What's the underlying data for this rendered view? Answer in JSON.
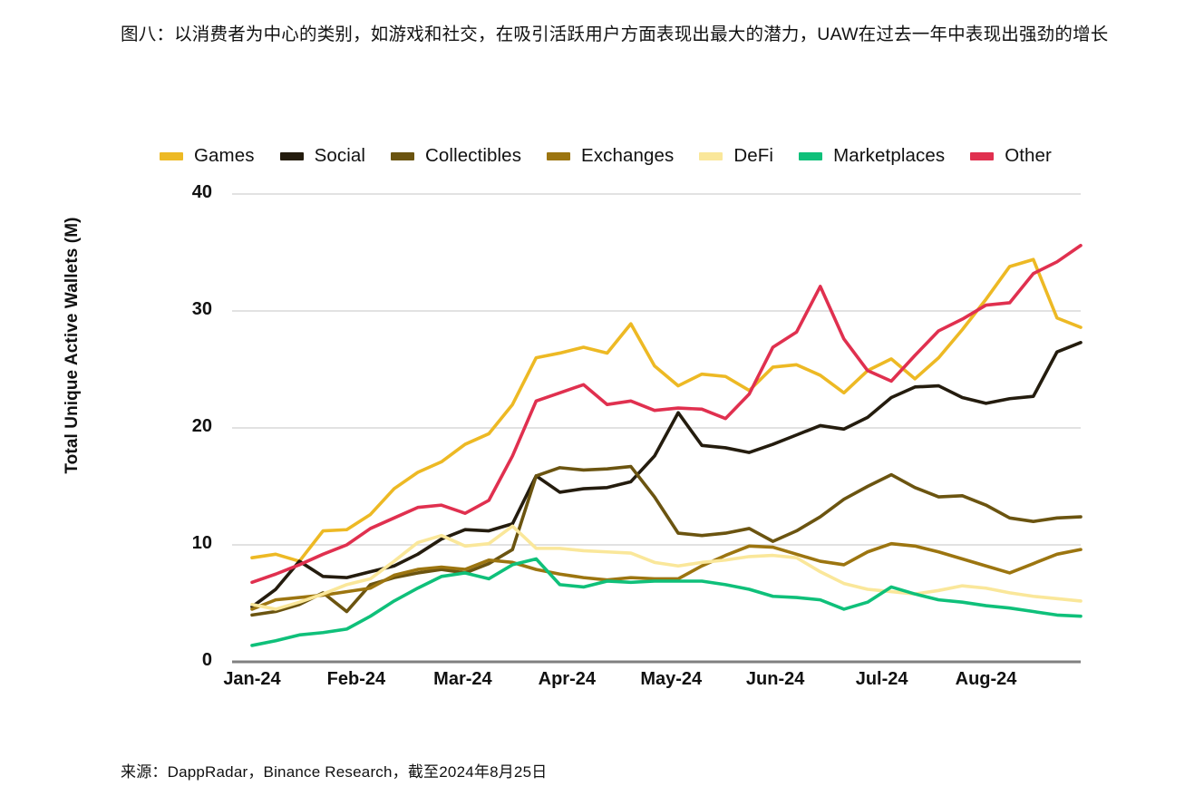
{
  "figure": {
    "title": "图八：以消费者为中心的类别，如游戏和社交，在吸引活跃用户方面表现出最大的潜力，UAW在过去一年中表现出强劲的增长",
    "source": "来源：DappRadar，Binance Research，截至2024年8月25日"
  },
  "chart_data": {
    "type": "line",
    "title": "",
    "subtitle": "",
    "xlabel": "",
    "ylabel": "Total Unique Active Wallets (M)",
    "ylim": [
      0,
      40
    ],
    "yticks": [
      0,
      10,
      20,
      30,
      40
    ],
    "ytick_labels": [
      "0",
      "10",
      "20",
      "30",
      "40"
    ],
    "xtick_labels": [
      "Jan-24",
      "Feb-24",
      "Mar-24",
      "Apr-24",
      "May-24",
      "Jun-24",
      "Jul-24",
      "Aug-24"
    ],
    "xtick_indices": [
      0,
      4.4,
      8.9,
      13.3,
      17.7,
      22.1,
      26.6,
      31.0
    ],
    "x_count": 35,
    "grid": "horizontal",
    "legend_position": "top-left",
    "series": [
      {
        "name": "Games",
        "color": "#EDB924",
        "values": [
          8.9,
          9.2,
          8.6,
          11.2,
          11.3,
          12.6,
          14.8,
          16.2,
          17.1,
          18.6,
          19.5,
          22.0,
          26.0,
          26.4,
          26.9,
          26.4,
          28.9,
          25.3,
          23.6,
          24.6,
          24.4,
          23.2,
          25.2,
          25.4,
          24.5,
          23.0,
          24.9,
          25.9,
          24.2,
          26.0,
          28.4,
          31.0,
          33.8,
          34.4,
          29.4,
          28.6
        ]
      },
      {
        "name": "Social",
        "color": "#241C0E",
        "values": [
          4.7,
          6.2,
          8.6,
          7.3,
          7.2,
          7.7,
          8.2,
          9.2,
          10.5,
          11.3,
          11.2,
          11.8,
          15.9,
          14.5,
          14.8,
          14.9,
          15.4,
          17.6,
          21.3,
          18.5,
          18.3,
          17.9,
          18.6,
          19.4,
          20.2,
          19.9,
          20.9,
          22.6,
          23.5,
          23.6,
          22.6,
          22.1,
          22.5,
          22.7,
          26.5,
          27.3
        ]
      },
      {
        "name": "Collectibles",
        "color": "#6B5410",
        "values": [
          4.0,
          4.3,
          4.9,
          5.9,
          4.3,
          6.6,
          7.2,
          7.6,
          7.9,
          7.6,
          8.4,
          9.6,
          15.9,
          16.6,
          16.4,
          16.5,
          16.7,
          14.1,
          11.0,
          10.8,
          11.0,
          11.4,
          10.3,
          11.2,
          12.4,
          13.9,
          15.0,
          16.0,
          14.9,
          14.1,
          14.2,
          13.4,
          12.3,
          12.0,
          12.3,
          12.4
        ]
      },
      {
        "name": "Exchanges",
        "color": "#9C7510",
        "values": [
          4.5,
          5.3,
          5.5,
          5.7,
          6.0,
          6.3,
          7.4,
          7.9,
          8.1,
          7.9,
          8.7,
          8.5,
          7.9,
          7.5,
          7.2,
          7.0,
          7.2,
          7.1,
          7.1,
          8.2,
          9.1,
          9.9,
          9.8,
          9.2,
          8.6,
          8.3,
          9.4,
          10.1,
          9.9,
          9.4,
          8.8,
          8.2,
          7.6,
          8.4,
          9.2,
          9.6
        ]
      },
      {
        "name": "DeFi",
        "color": "#FAE79A",
        "values": [
          4.9,
          4.5,
          5.1,
          5.8,
          6.6,
          7.1,
          8.6,
          10.2,
          10.8,
          9.9,
          10.1,
          11.6,
          9.7,
          9.7,
          9.5,
          9.4,
          9.3,
          8.5,
          8.2,
          8.5,
          8.7,
          9.0,
          9.1,
          8.9,
          7.7,
          6.7,
          6.2,
          6.0,
          5.8,
          6.1,
          6.5,
          6.3,
          5.9,
          5.6,
          5.4,
          5.2
        ]
      },
      {
        "name": "Marketplaces",
        "color": "#0FC07A",
        "values": [
          1.4,
          1.8,
          2.3,
          2.5,
          2.8,
          3.9,
          5.2,
          6.3,
          7.3,
          7.6,
          7.1,
          8.3,
          8.8,
          6.6,
          6.4,
          6.9,
          6.8,
          6.9,
          6.9,
          6.9,
          6.6,
          6.2,
          5.6,
          5.5,
          5.3,
          4.5,
          5.1,
          6.4,
          5.8,
          5.3,
          5.1,
          4.8,
          4.6,
          4.3,
          4.0,
          3.9
        ]
      },
      {
        "name": "Other",
        "color": "#E0304F",
        "values": [
          6.8,
          7.5,
          8.3,
          9.2,
          10.0,
          11.4,
          12.3,
          13.2,
          13.4,
          12.7,
          13.8,
          17.6,
          22.3,
          23.0,
          23.7,
          22.0,
          22.3,
          21.5,
          21.7,
          21.6,
          20.8,
          22.9,
          26.9,
          28.2,
          32.1,
          27.6,
          24.9,
          24.0,
          26.2,
          28.3,
          29.3,
          30.5,
          30.7,
          33.2,
          34.2,
          35.6
        ]
      }
    ]
  }
}
